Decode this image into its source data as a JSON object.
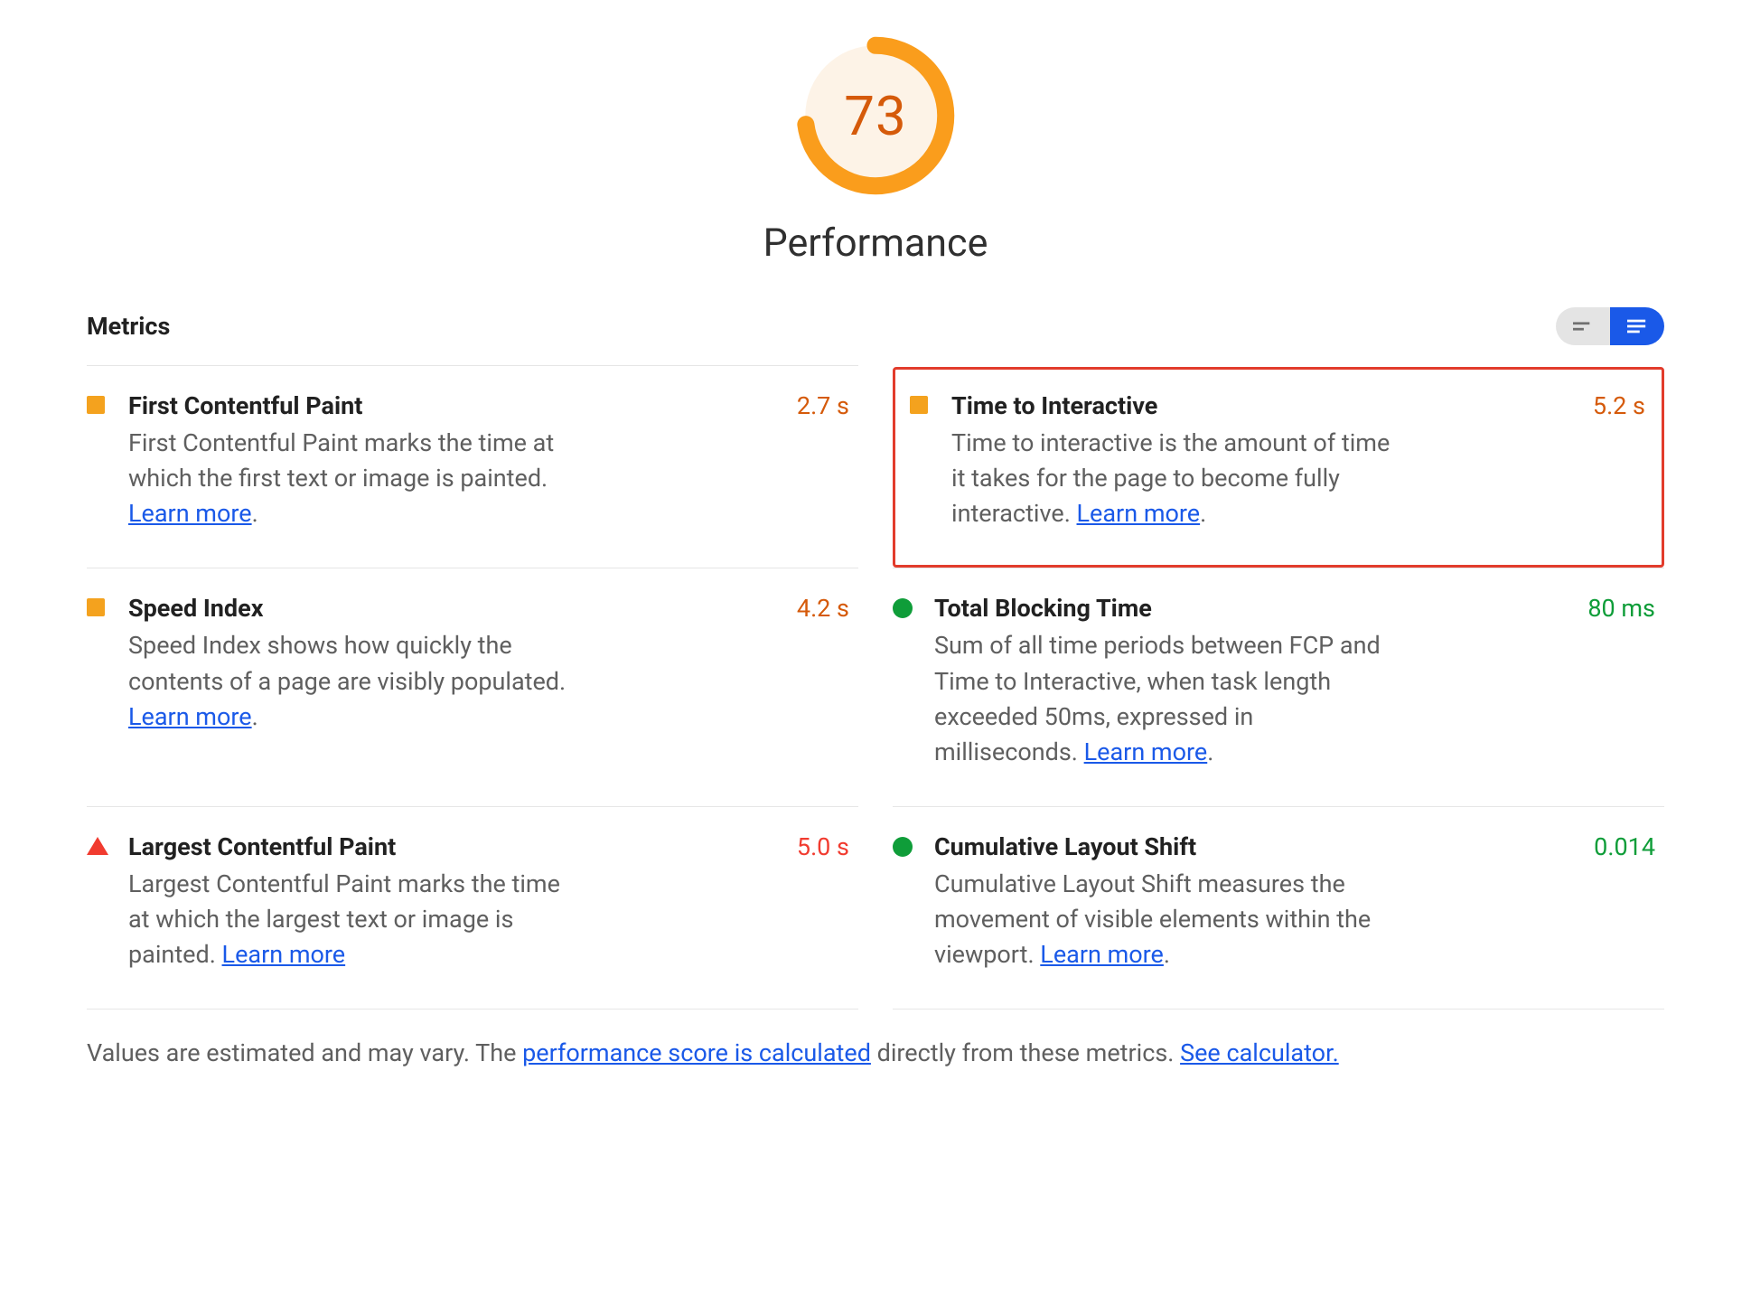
{
  "score": {
    "value": "73",
    "percent": 73,
    "label": "Performance"
  },
  "colors": {
    "orange": "#fa9d1c",
    "orange_dark": "#d55a0a",
    "red": "#f13b2f",
    "green": "#0f9d39",
    "blue": "#1a59e8"
  },
  "section_title": "Metrics",
  "learn_more": "Learn more",
  "metrics": {
    "fcp": {
      "name": "First Contentful Paint",
      "desc": "First Contentful Paint marks the time at which the first text or image is painted. ",
      "value": "2.7 s",
      "status": "average",
      "period": "."
    },
    "tti": {
      "name": "Time to Interactive",
      "desc": "Time to interactive is the amount of time it takes for the page to become fully interactive. ",
      "value": "5.2 s",
      "status": "average",
      "period": "."
    },
    "si": {
      "name": "Speed Index",
      "desc": "Speed Index shows how quickly the contents of a page are visibly populated. ",
      "value": "4.2 s",
      "status": "average",
      "period": "."
    },
    "tbt": {
      "name": "Total Blocking Time",
      "desc": "Sum of all time periods between FCP and Time to Interactive, when task length exceeded 50ms, expressed in milliseconds. ",
      "value": "80 ms",
      "status": "good",
      "period": "."
    },
    "lcp": {
      "name": "Largest Contentful Paint",
      "desc": "Largest Contentful Paint marks the time at which the largest text or image is painted. ",
      "value": "5.0 s",
      "status": "poor",
      "period": ""
    },
    "cls": {
      "name": "Cumulative Layout Shift",
      "desc": "Cumulative Layout Shift measures the movement of visible elements within the viewport. ",
      "value": "0.014",
      "status": "good",
      "period": "."
    }
  },
  "footer": {
    "pre": "Values are estimated and may vary. The ",
    "link1": "performance score is calculated",
    "mid": " directly from these metrics. ",
    "link2": "See calculator."
  }
}
